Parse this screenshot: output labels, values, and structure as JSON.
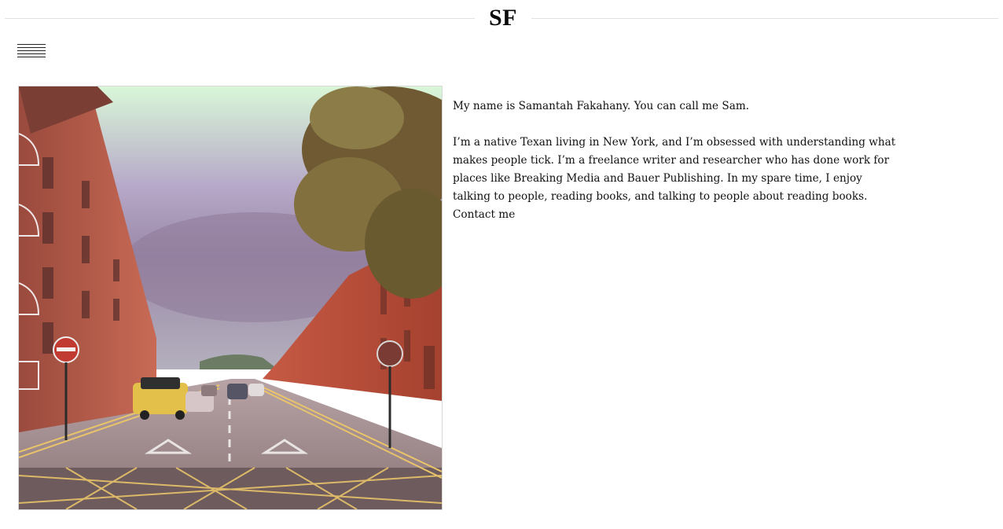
{
  "header": {
    "logo": "SF"
  },
  "menu": {
    "icon": "hamburger-menu-icon"
  },
  "photo": {
    "subject": "street-photo"
  },
  "bio": {
    "intro": "My name is Samantah Fakahany. You can call me Sam.",
    "body": "I’m a native Texan living in New York, and I’m obsessed with understanding what makes people tick. I’m a freelance writer and researcher who has done work for places like Breaking Media and Bauer Publishing. In my spare time, I enjoy talking to people, reading books, and talking to people about reading books.",
    "contact_link": "Contact me"
  }
}
